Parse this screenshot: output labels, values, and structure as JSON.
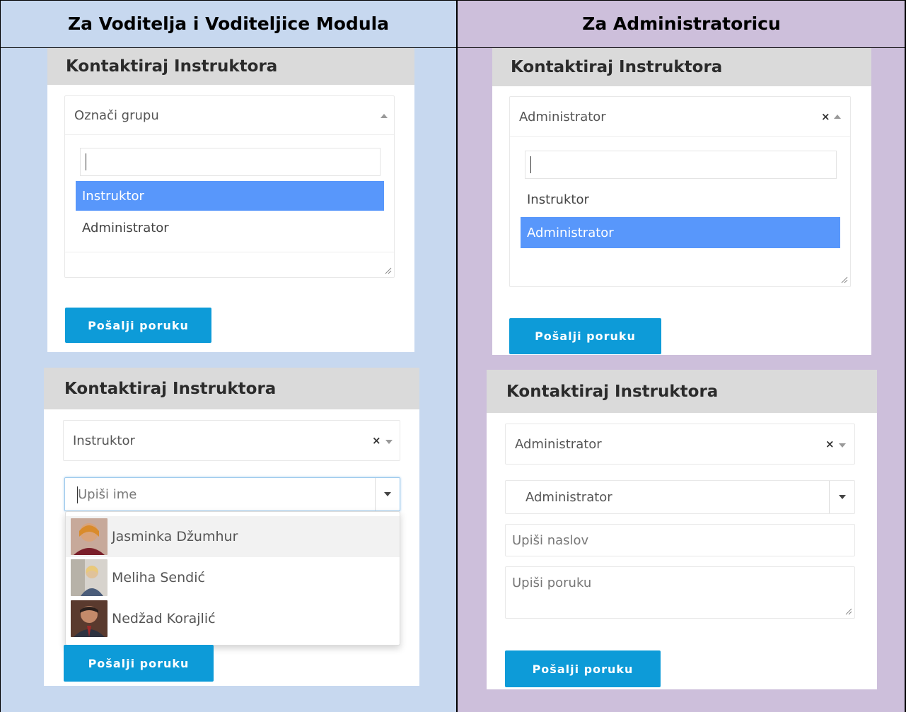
{
  "table": {
    "left_header": "Za Voditelja i Voditeljice Modula",
    "right_header": "Za Administratoricu",
    "left_bg": "#c7d8ef",
    "right_bg": "#cdbfdb"
  },
  "panels": {
    "p1": {
      "title": "Kontaktiraj Instruktora",
      "select_value": "Označi grupu",
      "options": [
        "Instruktor",
        "Administrator"
      ],
      "highlighted": "Instruktor",
      "button": "Pošalji poruku"
    },
    "p2": {
      "title": "Kontaktiraj Instruktora",
      "select_value": "Administrator",
      "options": [
        "Instruktor",
        "Administrator"
      ],
      "highlighted": "Administrator",
      "button": "Pošalji poruku"
    },
    "p3": {
      "title": "Kontaktiraj Instruktora",
      "select_value": "Instruktor",
      "name_placeholder": "Upiši ime",
      "people": [
        "Jasminka Džumhur",
        "Meliha Sendić",
        "Nedžad Korajlić"
      ],
      "button": "Pošalji poruku"
    },
    "p4": {
      "title": "Kontaktiraj Instruktora",
      "select_value": "Administrator",
      "name_value": "Administrator",
      "subject_placeholder": "Upiši naslov",
      "message_placeholder": "Upiši poruku",
      "button": "Pošalji poruku"
    }
  },
  "colors": {
    "accent_button": "#0d9bd8",
    "highlight": "#5897fb",
    "panel_header": "#dadada"
  }
}
